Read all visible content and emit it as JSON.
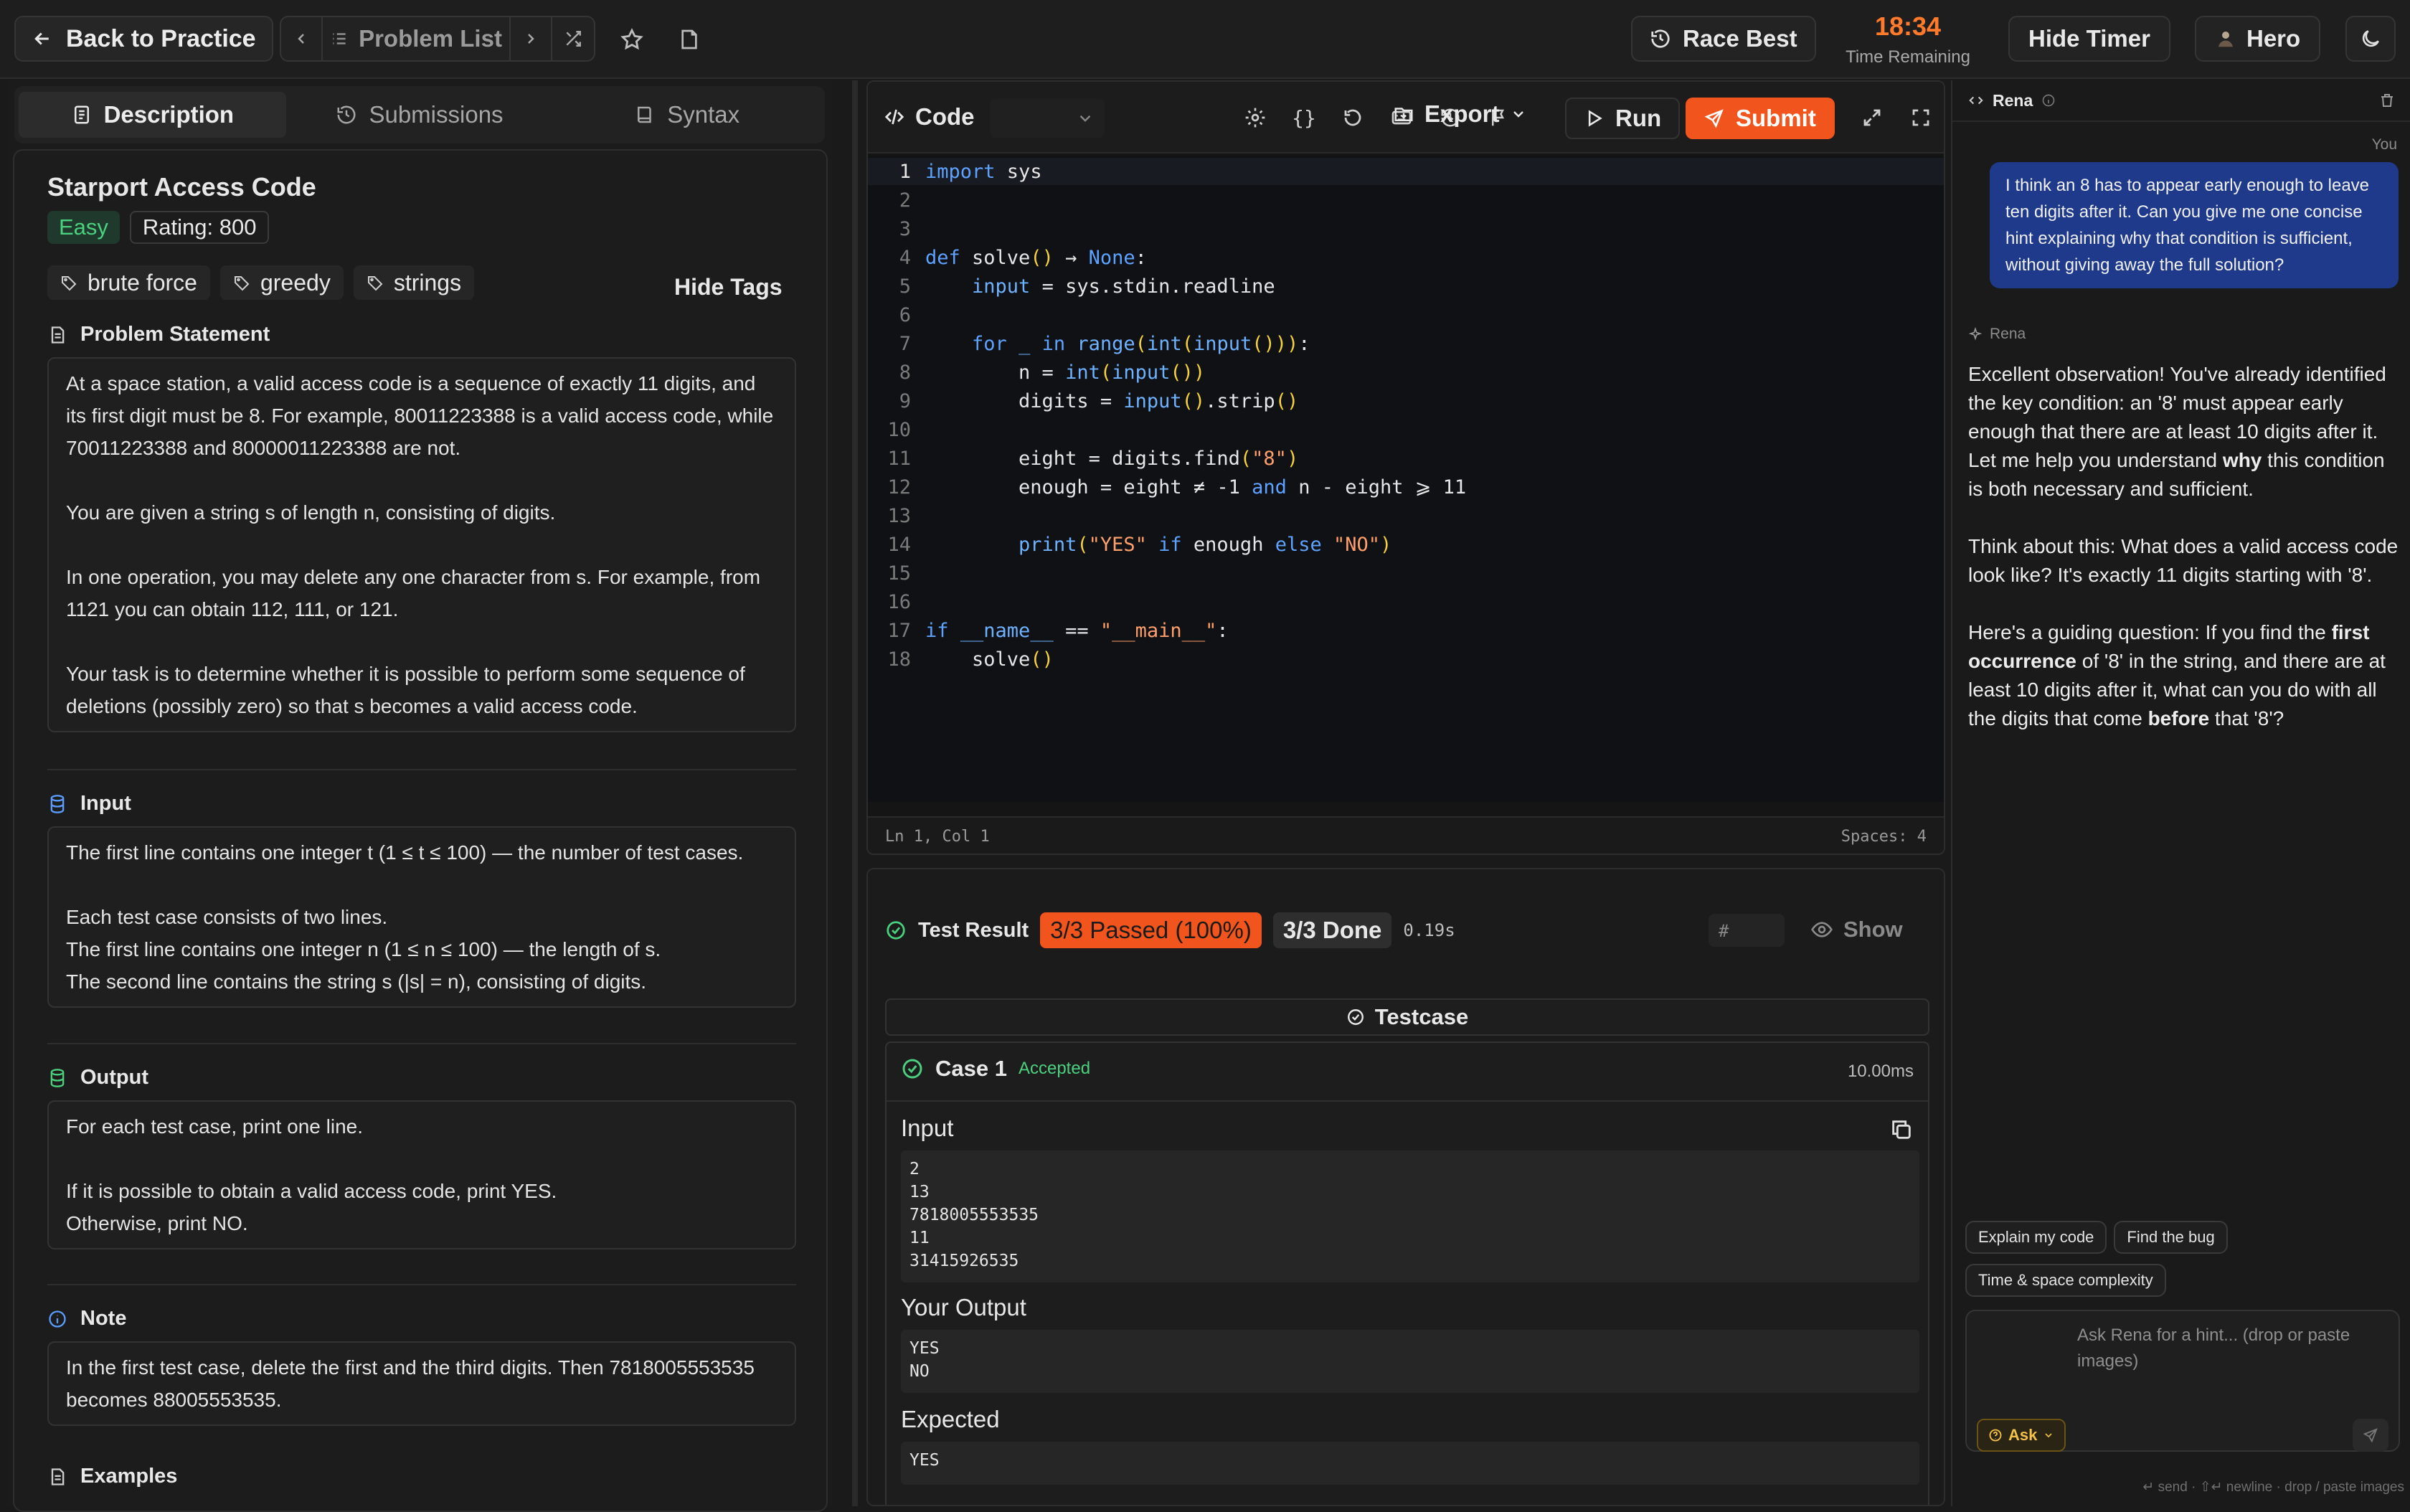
{
  "topbar": {
    "back_label": "Back to Practice",
    "problem_list_label": "Problem List",
    "race_best_label": "Race Best",
    "timer_value": "18:34",
    "timer_label": "Time Remaining",
    "hide_timer_label": "Hide Timer",
    "user_label": "Hero"
  },
  "left": {
    "tabs": [
      {
        "label": "Description"
      },
      {
        "label": "Submissions"
      },
      {
        "label": "Syntax"
      }
    ],
    "title": "Starport Access Code",
    "difficulty": "Easy",
    "rating": "Rating: 800",
    "tags": [
      "brute force",
      "greedy",
      "strings"
    ],
    "hide_tags_label": "Hide Tags",
    "statement_heading": "Problem Statement",
    "statement": [
      "At a space station, a valid access code is a sequence of exactly 11 digits, and its first digit must be 8. For example, 80011223388 is a valid access code, while 70011223388 and 80000011223388 are not.",
      "You are given a string s of length n, consisting of digits.",
      "In one operation, you may delete any one character from s. For example, from 1121 you can obtain 112, 111, or 121.",
      "Your task is to determine whether it is possible to perform some sequence of deletions (possibly zero) so that s becomes a valid access code."
    ],
    "input_heading": "Input",
    "input_text": [
      "The first line contains one integer t (1 ≤ t ≤ 100) — the number of test cases.",
      "Each test case consists of two lines.",
      "The first line contains one integer n (1 ≤ n ≤ 100) — the length of s.",
      "The second line contains the string s (|s| = n), consisting of digits."
    ],
    "output_heading": "Output",
    "output_text": [
      "For each test case, print one line.",
      "If it is possible to obtain a valid access code, print YES.",
      "Otherwise, print NO."
    ],
    "note_heading": "Note",
    "note_text": "In the first test case, delete the first and the third digits. Then 7818005553535 becomes 88005553535.",
    "examples_heading": "Examples"
  },
  "editor": {
    "code_label": "Code",
    "export_label": "Export",
    "run_label": "Run",
    "submit_label": "Submit",
    "status_left": "Ln 1, Col 1",
    "status_right": "Spaces: 4"
  },
  "results": {
    "label": "Test Result",
    "passed": "3/3 Passed (100%)",
    "done": "3/3 Done",
    "time": "0.19s",
    "hash_placeholder": "#",
    "show_label": "Show",
    "testcase_label": "Testcase",
    "case_title": "Case 1",
    "case_status": "Accepted",
    "case_time": "10.00ms",
    "input_label": "Input",
    "input_value": "2\n13\n7818005553535\n11\n31415926535",
    "your_output_label": "Your Output",
    "your_output_value": "YES\nNO",
    "expected_label": "Expected",
    "expected_value": "YES"
  },
  "chat": {
    "assistant_name": "Rena",
    "you_label": "You",
    "user_message": "I think an 8 has to appear early enough to leave ten digits after it. Can you give me one concise hint explaining why that condition is sufficient, without giving away the full solution?",
    "reply_p1_a": "Excellent observation! You've already identified the key condition: an '8' must appear early enough that there are at least 10 digits after it. Let me help you understand ",
    "reply_p1_b": "why",
    "reply_p1_c": " this condition is both necessary and sufficient.",
    "reply_p2": "Think about this: What does a valid access code look like? It's exactly 11 digits starting with '8'.",
    "reply_p3_a": "Here's a guiding question: If you find the ",
    "reply_p3_b": "first occurrence",
    "reply_p3_c": " of '8' in the string, and there are at least 10 digits after it, what can you do with all the digits that come ",
    "reply_p3_d": "before",
    "reply_p3_e": " that '8'?",
    "chips": [
      "Explain my code",
      "Find the bug",
      "Time & space complexity"
    ],
    "input_placeholder": "Ask Rena for a hint... (drop or paste images)",
    "ask_label": "Ask",
    "footer_hint": "↵ send · ⇧↵ newline · drop / paste images"
  },
  "colors": {
    "accent": "#f1541c",
    "timer": "#ff7a2a",
    "success": "#4bd07f",
    "user_bubble": "#1f3a8a"
  }
}
